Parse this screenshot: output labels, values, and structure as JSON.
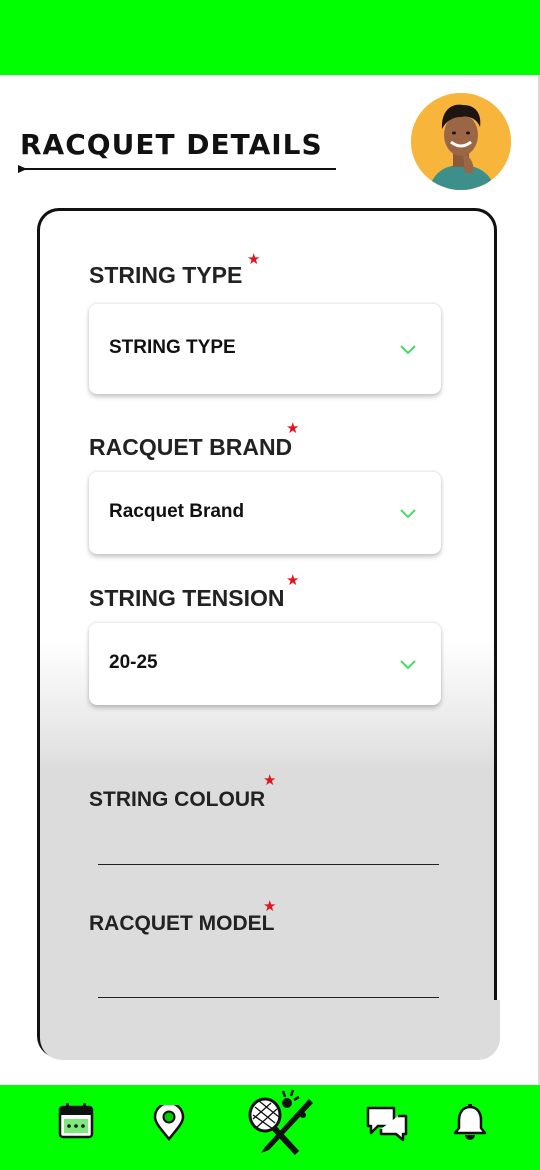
{
  "header": {
    "title": "RACQUET DETAILS"
  },
  "form": {
    "string_type": {
      "label": "STRING TYPE",
      "value": "STRING TYPE"
    },
    "racquet_brand": {
      "label": "RACQUET BRAND",
      "value": "Racquet Brand"
    },
    "string_tension": {
      "label": "STRING TENSION",
      "value": "20-25"
    },
    "string_colour": {
      "label": "STRING COLOUR",
      "value": ""
    },
    "racquet_model": {
      "label": "RACQUET MODEL",
      "value": ""
    },
    "required_mark": "★"
  },
  "colors": {
    "brand_green": "#00ff00",
    "required_red": "#e0151d",
    "chevron_green": "#4cd964"
  },
  "nav": {
    "items": [
      "calendar-icon",
      "location-pin-icon",
      "racquet-logo-icon",
      "chat-icon",
      "bell-icon"
    ]
  }
}
